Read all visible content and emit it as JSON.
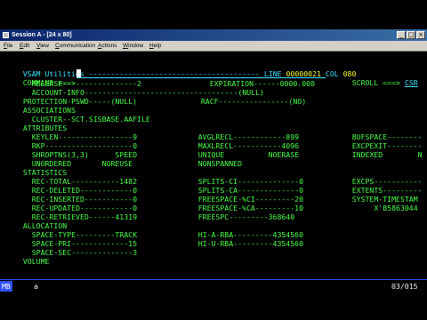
{
  "window": {
    "title": "Session A - [24 x 80]",
    "controls": [
      "_",
      "□",
      "×"
    ]
  },
  "menu": [
    "File",
    "Edit",
    "View",
    "Communication",
    "Actions",
    "Window",
    "Help"
  ],
  "screen": {
    "header": {
      "title": "VSAM Utilities",
      "dashes": "---------------------------------------",
      "line_label": "LINE",
      "line_value": "00000021",
      "col_label": "COL",
      "col_value": "080"
    },
    "command": {
      "label": "COMMAND ===>",
      "scroll_label": "SCROLL ===>",
      "scroll_value": "CSR"
    },
    "rows": [
      [
        "    RELEASE-----------------2",
        "    EXPIRATION------0000.000"
      ],
      [
        "    ACCOUNT-INFO-----------------------------------(NULL)"
      ],
      [
        "  PROTECTION-PSWD-----(NULL)",
        "  RACF----------------(NO)"
      ],
      [
        "  ASSOCIATIONS"
      ],
      [
        "    CLUSTER--SCT.SISBASE.AAFILE"
      ],
      [
        "  ATTRIBUTES"
      ],
      [
        "    KEYLEN-----------------9",
        "    AVGLRECL------------899",
        "    BUFSPACE--------"
      ],
      [
        "    RKP--------------------0",
        "    MAXLRECL-----------4096",
        "    EXCPEXIT--------"
      ],
      [
        "    SHROPTNS(3,3)      SPEED",
        "    UNIQUE          NOERASE",
        "    INDEXED        N"
      ],
      [
        "    UNORDERED       NOREUSE",
        "    NONSPANNED"
      ],
      [
        "  STATISTICS"
      ],
      [
        "    REC-TOTAL-----------1482",
        "    SPLITS-CI--------------0",
        "    EXCPS-----------"
      ],
      [
        "    REC-DELETED------------0",
        "    SPLITS-CA--------------0",
        "    EXTENTS---------"
      ],
      [
        "    REC-INSERTED-----------0",
        "    FREESPACE-%CI---------20",
        "    SYSTEM-TIMESTAM"
      ],
      [
        "    REC-UPDATED------------0",
        "    FREESPACE-%CA---------10",
        "         X'B5863044"
      ],
      [
        "    REC-RETRIEVED------41319",
        "    FREESPC---------368640"
      ],
      [
        "  ALLOCATION"
      ],
      [
        "    SPACE-TYPE---------TRACK",
        "    HI-A-RBA---------4354560"
      ],
      [
        "    SPACE-PRI-------------15",
        "    HI-U-RBA---------4354560"
      ],
      [
        "    SPACE-SEC--------------3"
      ],
      [
        "  VOLUME"
      ]
    ]
  },
  "status": {
    "mode": "MB",
    "indicator": "a",
    "cursor_pos": "03/015"
  },
  "colors": {
    "text_turquoise": "#40e0ff",
    "text_green": "#4cff4c",
    "text_yellow": "#ffff40",
    "title_bar": "#0a246a",
    "menu_bg": "#d4d0c8"
  }
}
